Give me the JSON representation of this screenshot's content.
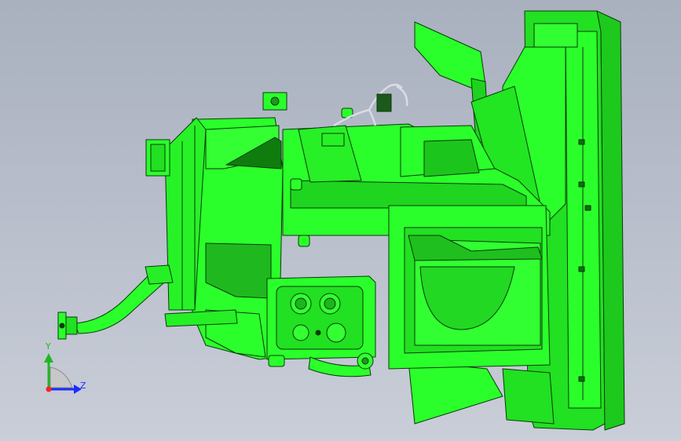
{
  "viewport": {
    "background_top": "#a9b0be",
    "background_bottom": "#c9ced8",
    "model_color": "#2bff2b",
    "model_shadow": "#1fbf1f",
    "model_dark": "#0f8a0f",
    "edge_color": "#0a3a0a"
  },
  "triad": {
    "y_label": "Y",
    "z_label": "Z",
    "y_color": "#1fb81f",
    "z_color": "#1a2cff",
    "origin_color": "#ff2020"
  }
}
